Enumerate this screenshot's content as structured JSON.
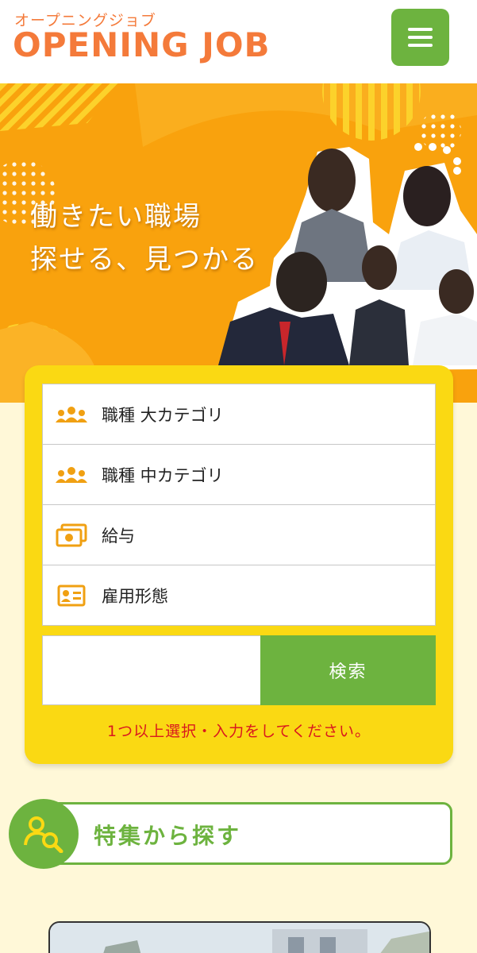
{
  "header": {
    "logo_kana": "オープニングジョブ",
    "logo_main": "OPENING JOB",
    "menu_icon": "hamburger-icon"
  },
  "hero": {
    "line1": "働きたい職場",
    "line2": "探せる、見つかる"
  },
  "search": {
    "fields": [
      {
        "label": "職種 大カテゴリ",
        "icon": "people-group-icon"
      },
      {
        "label": "職種 中カテゴリ",
        "icon": "people-group-icon"
      },
      {
        "label": "給与",
        "icon": "money-icon"
      },
      {
        "label": "雇用形態",
        "icon": "id-card-icon"
      }
    ],
    "keyword_value": "",
    "button_label": "検索",
    "warning": "1つ以上選択・入力をしてください。"
  },
  "feature": {
    "title": "特集から探す",
    "icon": "person-search-icon"
  },
  "colors": {
    "brand_orange": "#f47a3a",
    "hero_orange": "#f9a20d",
    "accent_green": "#6db33f",
    "card_yellow": "#fad913",
    "warning_red": "#d9181e",
    "page_bg": "#fff8d8"
  }
}
